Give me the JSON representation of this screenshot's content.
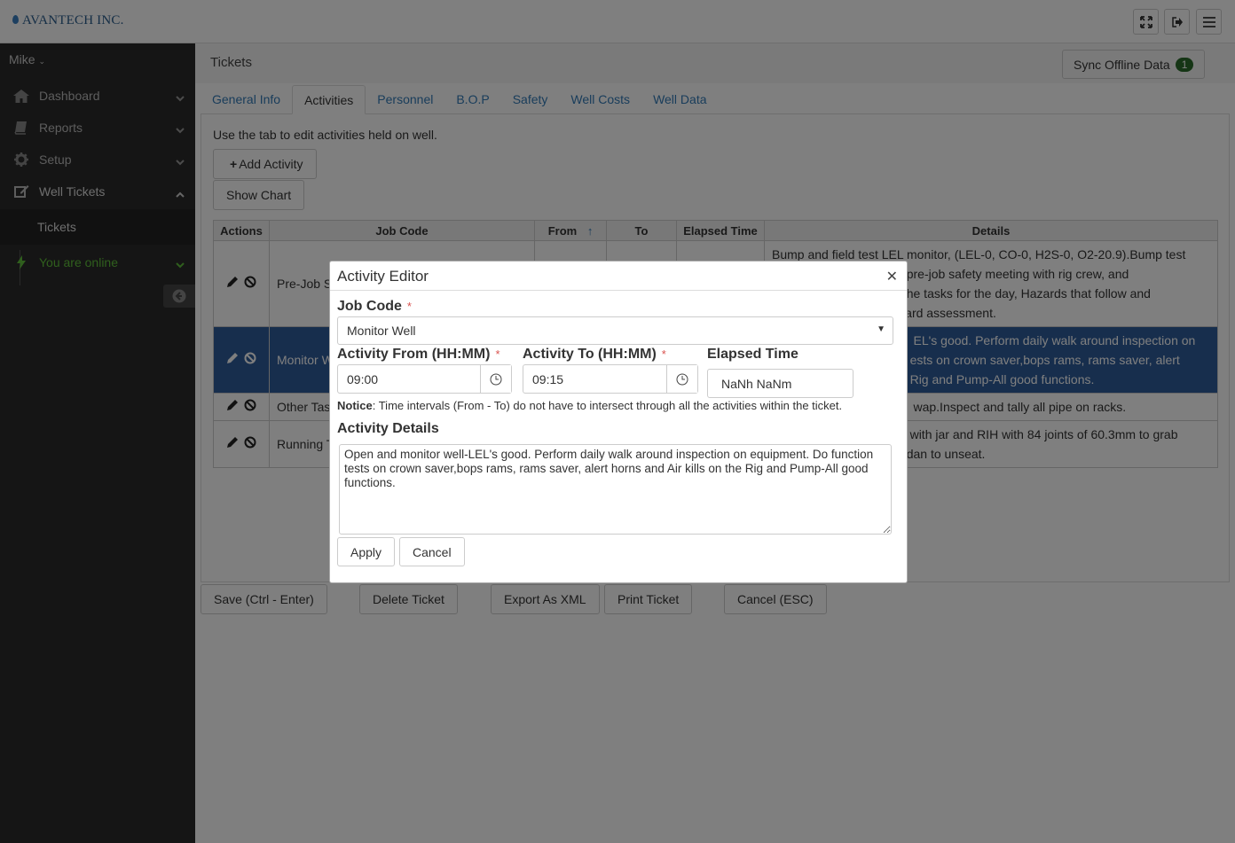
{
  "app": {
    "brand": "AVANTECH INC."
  },
  "sidebar": {
    "user": "Mike",
    "items": [
      {
        "label": "Dashboard",
        "icon": "home-icon"
      },
      {
        "label": "Reports",
        "icon": "book-icon"
      },
      {
        "label": "Setup",
        "icon": "gear-icon"
      },
      {
        "label": "Well Tickets",
        "icon": "edit-icon"
      }
    ],
    "sub_item": "Tickets",
    "status": "You are online"
  },
  "header": {
    "title": "Tickets",
    "sync_label": "Sync Offline Data",
    "sync_count": "1"
  },
  "tabs": [
    "General Info",
    "Activities",
    "Personnel",
    "B.O.P",
    "Safety",
    "Well Costs",
    "Well Data"
  ],
  "activities": {
    "description": "Use the tab to edit activities held on well.",
    "add_button": "Add Activity",
    "chart_button": "Show Chart",
    "columns": [
      "Actions",
      "Job Code",
      "From",
      "To",
      "Elapsed Time",
      "Details"
    ],
    "rows": [
      {
        "job": "Pre-Job S",
        "details": "Bump and field test LEL monitor, (LEL-0, CO-0, H2S-0, O2-20.9).Bump test all                           Hold pre-job safety meeting with rig crew, and                             about the tasks for the day, Hazards that follow and steps                              ard assessment."
      },
      {
        "job": "Monitor W",
        "details": "                                         EL's good. Perform daily walk around inspection on                                         ests on crown saver,bops rams, rams saver, alert                                         Rig and Pump-All good functions."
      },
      {
        "job": "Other Tas",
        "details": "                                         wap.Inspect and tally all pipe on racks."
      },
      {
        "job": "Running T",
        "details": "                                        with jar and RIH with 84 joints of 60.3mm to grab                                        dan to unseat."
      }
    ]
  },
  "footer": {
    "save": "Save (Ctrl - Enter)",
    "delete": "Delete Ticket",
    "export": "Export As XML",
    "print": "Print Ticket",
    "cancel": "Cancel (ESC)"
  },
  "modal": {
    "title": "Activity Editor",
    "job_code_label": "Job Code",
    "job_code_value": "Monitor Well",
    "from_label": "Activity From (HH:MM)",
    "from_value": "09:00",
    "to_label": "Activity To (HH:MM)",
    "to_value": "09:15",
    "elapsed_label": "Elapsed Time",
    "elapsed_value": "NaNh NaNm",
    "notice_bold": "Notice",
    "notice_text": ": Time intervals (From - To) do not have to intersect through all the activities within the ticket.",
    "details_label": "Activity Details",
    "details_value": "Open and monitor well-LEL's good. Perform daily walk around inspection on equipment. Do function tests on crown saver,bops rams, rams saver, alert horns and Air kills on the Rig and Pump-All good functions.",
    "apply": "Apply",
    "cancel": "Cancel",
    "required_mark": "*"
  }
}
